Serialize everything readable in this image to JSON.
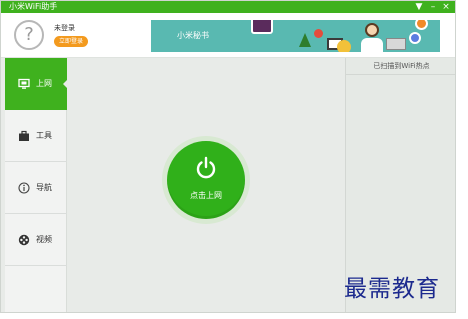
{
  "window": {
    "title": "小米WiFi助手",
    "controls": {
      "wifi": "▼",
      "minimize": "–",
      "close": "×"
    }
  },
  "header": {
    "help_icon": "?",
    "login_status": "未登录",
    "login_button": "立即登录",
    "banner_label": "小米秘书"
  },
  "sidebar": {
    "items": [
      {
        "label": "上网",
        "icon": "monitor-icon",
        "active": true
      },
      {
        "label": "工具",
        "icon": "toolbox-icon",
        "active": false
      },
      {
        "label": "导航",
        "icon": "info-icon",
        "active": false
      },
      {
        "label": "视频",
        "icon": "video-icon",
        "active": false
      }
    ]
  },
  "main": {
    "power_button_label": "点击上网",
    "power_icon": "power-icon"
  },
  "right_panel": {
    "title": "已扫描到WiFi热点"
  },
  "watermark": "最需教育",
  "colors": {
    "brand_green": "#3fb11e",
    "login_orange": "#f39a1e",
    "banner_teal": "#59b9b1",
    "watermark_blue": "#1c2a8e"
  }
}
